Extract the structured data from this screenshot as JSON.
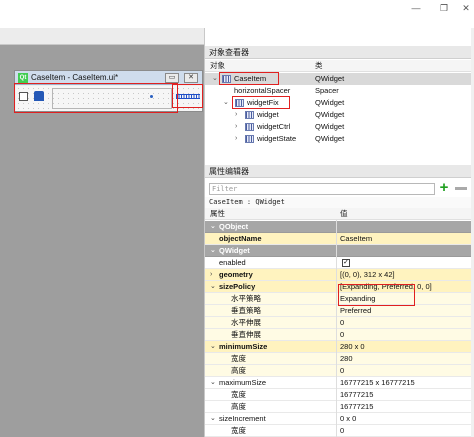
{
  "window": {
    "controls": [
      "—",
      "❐",
      "✕"
    ]
  },
  "form_window": {
    "title": "CaseItem - CaseItem.ui*",
    "icon_text": "Qt",
    "controls": [
      "▭",
      "✕"
    ]
  },
  "object_inspector": {
    "title": "对象查看器",
    "col_object": "对象",
    "col_class": "类",
    "rows": [
      {
        "name": "CaseItem",
        "cls": "QWidget"
      },
      {
        "name": "horizontalSpacer",
        "cls": "Spacer"
      },
      {
        "name": "widgetFix",
        "cls": "QWidget"
      },
      {
        "name": "widget",
        "cls": "QWidget"
      },
      {
        "name": "widgetCtrl",
        "cls": "QWidget"
      },
      {
        "name": "widgetState",
        "cls": "QWidget"
      }
    ]
  },
  "property_editor": {
    "title": "属性编辑器",
    "filter_placeholder": "Filter",
    "object_caption": "CaseItem : QWidget",
    "col_property": "属性",
    "col_value": "值",
    "rows": [
      {
        "name": "QObject",
        "value": ""
      },
      {
        "name": "objectName",
        "value": "CaseItem"
      },
      {
        "name": "QWidget",
        "value": ""
      },
      {
        "name": "enabled",
        "value": "✓"
      },
      {
        "name": "geometry",
        "value": "[(0, 0), 312 x 42]"
      },
      {
        "name": "sizePolicy",
        "value": "[Expanding, Preferred, 0, 0]"
      },
      {
        "name": "水平策略",
        "value": "Expanding"
      },
      {
        "name": "垂直策略",
        "value": "Preferred"
      },
      {
        "name": "水平伸展",
        "value": "0"
      },
      {
        "name": "垂直伸展",
        "value": "0"
      },
      {
        "name": "minimumSize",
        "value": "280 x 0"
      },
      {
        "name": "宽度",
        "value": "280"
      },
      {
        "name": "高度",
        "value": "0"
      },
      {
        "name": "maximumSize",
        "value": "16777215 x 16777215"
      },
      {
        "name": "宽度",
        "value": "16777215"
      },
      {
        "name": "高度",
        "value": "16777215"
      },
      {
        "name": "sizeIncrement",
        "value": "0 x 0"
      },
      {
        "name": "宽度",
        "value": "0"
      }
    ]
  }
}
